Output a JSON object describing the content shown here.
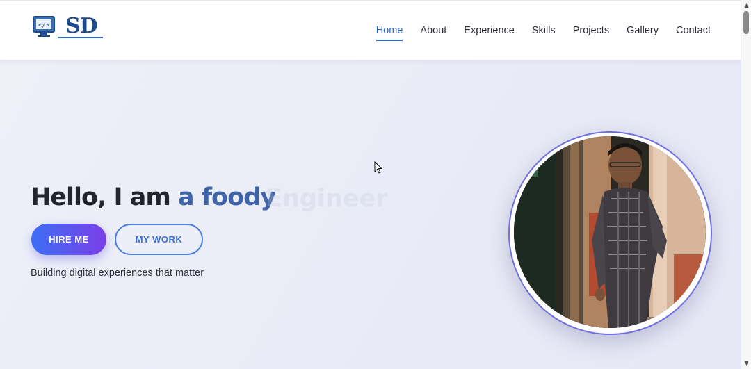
{
  "header": {
    "logo_text": "SD",
    "logo_icon": "code-monitor-icon",
    "nav": [
      {
        "label": "Home",
        "active": true
      },
      {
        "label": "About",
        "active": false
      },
      {
        "label": "Experience",
        "active": false
      },
      {
        "label": "Skills",
        "active": false
      },
      {
        "label": "Projects",
        "active": false
      },
      {
        "label": "Gallery",
        "active": false
      },
      {
        "label": "Contact",
        "active": false
      }
    ]
  },
  "hero": {
    "greeting": "Hello, I am ",
    "role_typed": "a foody",
    "ghost_text": "Engineer",
    "buttons": {
      "hire": "HIRE ME",
      "work": "MY WORK"
    },
    "tagline": "Building digital experiences that matter"
  },
  "colors": {
    "accent": "#3f64a8",
    "nav_active": "#2f68c4",
    "gradient_start": "#3d6ef5",
    "gradient_end": "#7a3fe8",
    "hero_bg": "#e9ebf6"
  }
}
